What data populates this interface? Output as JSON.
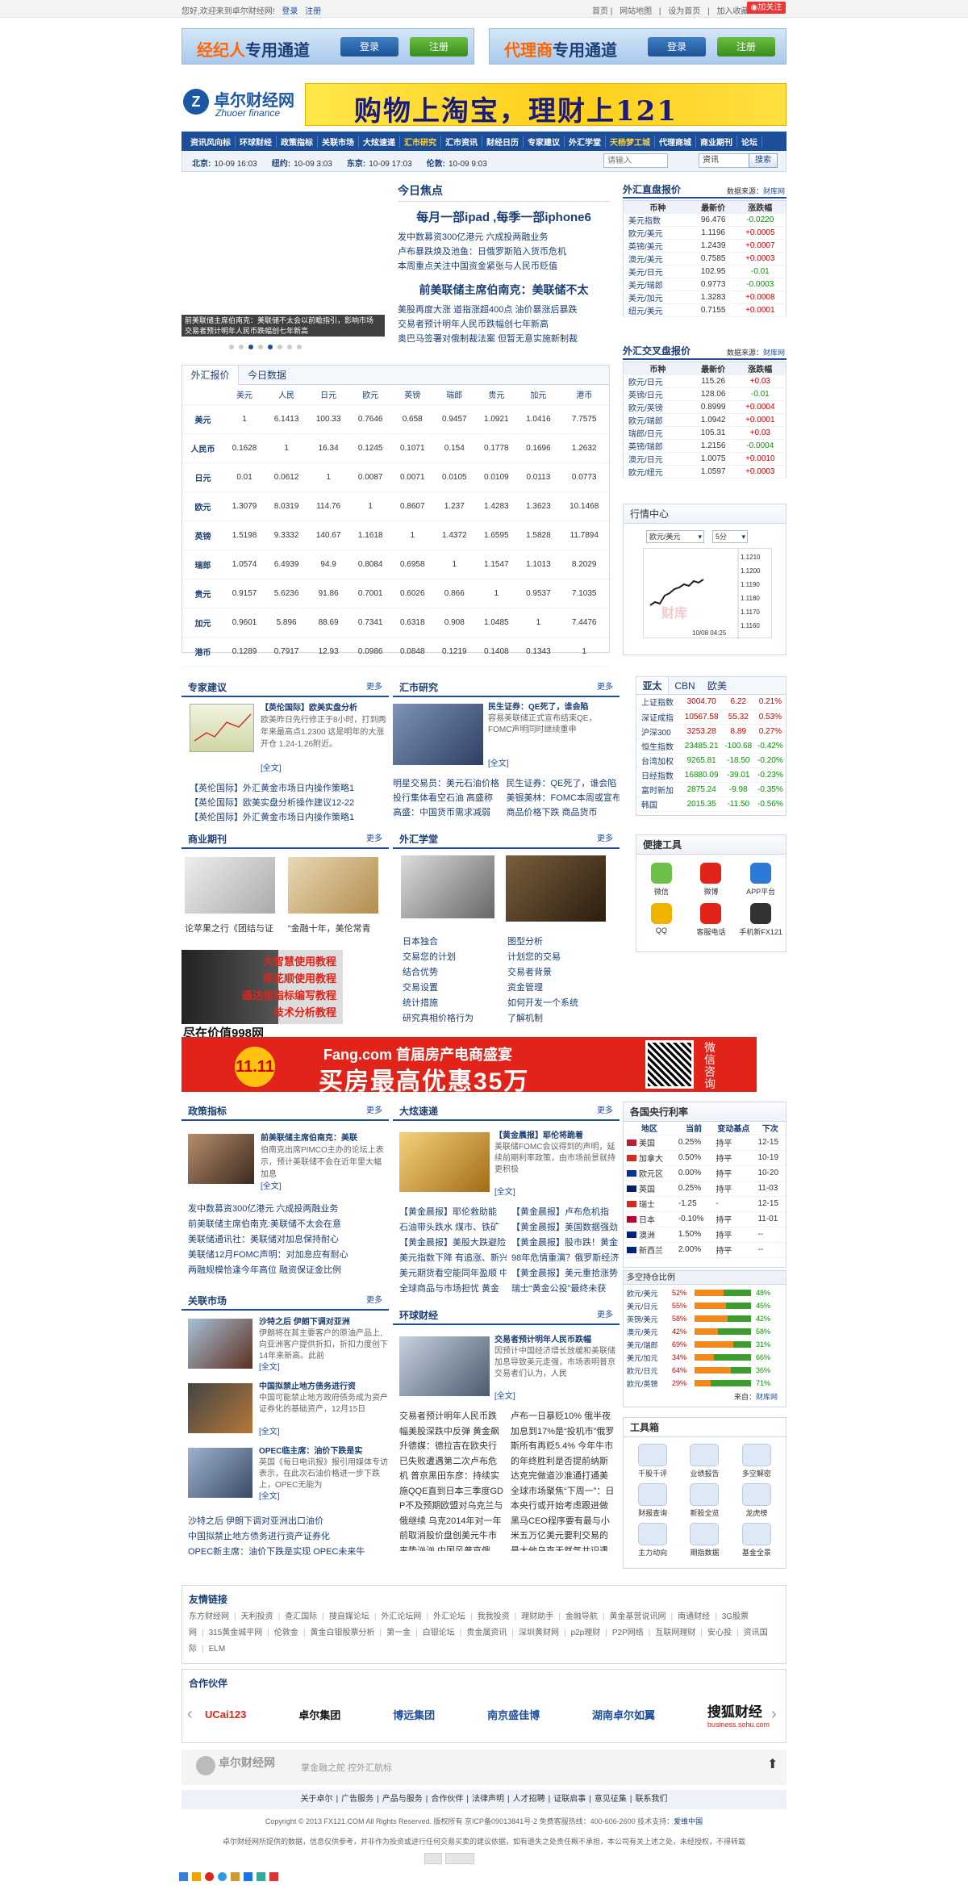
{
  "top": {
    "greet": "您好,欢迎来到卓尔财经网!",
    "login": "登录",
    "register": "注册",
    "home": "首页",
    "sitemap": "网站地图",
    "set_home": "设为首页",
    "bookmark": "加入收藏",
    "follow": "加关注"
  },
  "portal": {
    "broker": "经纪人",
    "broker_rest": "专用通道",
    "agent": "代理商",
    "agent_rest": "专用通道",
    "login": "登录",
    "register": "注册"
  },
  "brand": {
    "name": "卓尔财经网",
    "en": "Zhuoer finance",
    "ad": "购物上淘宝，理财上121"
  },
  "nav": {
    "row1": [
      "资讯风向标",
      "环球财经",
      "政策指标",
      "关联市场",
      "大炫速递",
      "汇市研究",
      "汇市资讯",
      "财经日历",
      "专家建议",
      "外汇学堂",
      "天杨梦工城",
      "代理商城",
      "商业期刊",
      "论坛"
    ]
  },
  "clock": {
    "items": [
      {
        "city": "北京:",
        "t": "10-09 16:03"
      },
      {
        "city": "纽约:",
        "t": "10-09 3:03"
      },
      {
        "city": "东京:",
        "t": "10-09 17:03"
      },
      {
        "city": "伦敦:",
        "t": "10-09 9:03"
      }
    ],
    "search_ph": "请输入",
    "select": "资讯",
    "search_btn": "搜索"
  },
  "hero": {
    "caption1": "前美联储主席伯南克：美联储不太会以前瞻指引，影响市场",
    "caption2": "交易者预计明年人民币跌幅创七年新高"
  },
  "focus": {
    "title": "今日焦点",
    "h1": "每月一部ipad ,每季一部iphone6",
    "list1": [
      "发中数募资300亿港元 六成投两融业务",
      "卢布暴跌焕及池鱼：日俄罗斯陷入货币危机",
      "本周重点关注中国资金紧张与人民币贬值"
    ],
    "h2": "前美联储主席伯南克：美联储不太",
    "list2": [
      "美股再度大涨 道指涨超400点 油价暴涨后暴跌",
      "交易者预计明年人民币跌幅创七年新高",
      "奥巴马签署对俄制裁法案 但暂无意实施新制裁"
    ]
  },
  "fxtab": {
    "tab1": "外汇报价",
    "tab2": "今日数据",
    "cols": [
      "",
      "美元",
      "人民",
      "日元",
      "欧元",
      "英镑",
      "瑞郎",
      "贵元",
      "加元",
      "港币"
    ],
    "rows": [
      [
        "美元",
        "1",
        "6.1413",
        "100.33",
        "0.7646",
        "0.658",
        "0.9457",
        "1.0921",
        "1.0416",
        "7.7575"
      ],
      [
        "人民币",
        "0.1628",
        "1",
        "16.34",
        "0.1245",
        "0.1071",
        "0.154",
        "0.1778",
        "0.1696",
        "1.2632"
      ],
      [
        "日元",
        "0.01",
        "0.0612",
        "1",
        "0.0087",
        "0.0071",
        "0.0105",
        "0.0109",
        "0.0113",
        "0.0773"
      ],
      [
        "欧元",
        "1.3079",
        "8.0319",
        "114.76",
        "1",
        "0.8607",
        "1.237",
        "1.4283",
        "1.3623",
        "10.1468"
      ],
      [
        "英镑",
        "1.5198",
        "9.3332",
        "140.67",
        "1.1618",
        "1",
        "1.4372",
        "1.6595",
        "1.5828",
        "11.7894"
      ],
      [
        "瑞郎",
        "1.0574",
        "6.4939",
        "94.9",
        "0.8084",
        "0.6958",
        "1",
        "1.1547",
        "1.1013",
        "8.2029"
      ],
      [
        "贵元",
        "0.9157",
        "5.6236",
        "91.86",
        "0.7001",
        "0.6026",
        "0.866",
        "1",
        "0.9537",
        "7.1035"
      ],
      [
        "加元",
        "0.9601",
        "5.896",
        "88.69",
        "0.7341",
        "0.6318",
        "0.908",
        "1.0485",
        "1",
        "7.4476"
      ],
      [
        "港币",
        "0.1289",
        "0.7917",
        "12.93",
        "0.0986",
        "0.0848",
        "0.1219",
        "0.1408",
        "0.1343",
        "1"
      ]
    ]
  },
  "direct": {
    "title": "外汇直盘报价",
    "source_l": "数据来源：",
    "source": "财库网",
    "cols": [
      "币种",
      "最新价",
      "涨跌幅"
    ],
    "rows": [
      [
        "美元指数",
        "96.476",
        "-0.0220"
      ],
      [
        "欧元/美元",
        "1.1196",
        "+0.0005"
      ],
      [
        "英镑/美元",
        "1.2439",
        "+0.0007"
      ],
      [
        "澳元/美元",
        "0.7585",
        "+0.0003"
      ],
      [
        "美元/日元",
        "102.95",
        "-0.01"
      ],
      [
        "美元/瑞郎",
        "0.9773",
        "-0.0003"
      ],
      [
        "美元/加元",
        "1.3283",
        "+0.0008"
      ],
      [
        "纽元/美元",
        "0.7155",
        "+0.0001"
      ]
    ]
  },
  "cross": {
    "title": "外汇交叉盘报价",
    "source_l": "数据来源：",
    "source": "财库网",
    "cols": [
      "币种",
      "最新价",
      "涨跌幅"
    ],
    "rows": [
      [
        "欧元/日元",
        "115.26",
        "+0.03"
      ],
      [
        "英镑/日元",
        "128.06",
        "-0.01"
      ],
      [
        "欧元/英镑",
        "0.8999",
        "+0.0004"
      ],
      [
        "欧元/瑞郎",
        "1.0942",
        "+0.0001"
      ],
      [
        "瑞郎/日元",
        "105.31",
        "+0.03"
      ],
      [
        "英镑/瑞郎",
        "1.2156",
        "-0.0004"
      ],
      [
        "澳元/日元",
        "1.0075",
        "+0.0010"
      ],
      [
        "欧元/纽元",
        "1.0597",
        "+0.0003"
      ]
    ]
  },
  "market": {
    "title": "行情中心",
    "pair": "欧元/美元",
    "period": "5分",
    "prices": [
      "1.1210",
      "1.1200",
      "1.1190",
      "1.1180",
      "1.1170",
      "1.1160"
    ],
    "watermark": "财库",
    "time": "10/08 04:25"
  },
  "expert": {
    "title": "专家建议",
    "more": "更多",
    "headline": "【英伦国际】欧美实盘分析",
    "desc": "欧美昨日先行修正于8小时，打到两年来最高点1.2300 这是明年的大涨开仓 1.24-1.26附近。",
    "full": "[全文]",
    "list": [
      "【英伦国际】外汇黄金市场日内操作策略1",
      "【英伦国际】欧美实盘分析操作建议12-22",
      "【英伦国际】外汇黄金市场日内操作策略1"
    ]
  },
  "research": {
    "title": "汇市研究",
    "more": "更多",
    "headline": "民生证券：QE死了，谁会陷",
    "desc": "容易美联储正式宣布结束QE，FOMC声明同时继续重申",
    "full": "[全文]",
    "list": [
      "明星交易员：美元石油价格",
      "民生证券：QE死了，谁会陷",
      "投行集体看空石油 高盛称",
      "美银美林：FOMC本周或宣布",
      "高盛：中国货币需求减弱",
      "商品价格下跌 商品货币"
    ]
  },
  "asia": {
    "tabs": [
      "亚太",
      "CBN",
      "欧美"
    ],
    "rows": [
      [
        "上证指数",
        "3004.70",
        "6.22",
        "0.21%"
      ],
      [
        "深证成指",
        "10567.58",
        "55.32",
        "0.53%"
      ],
      [
        "沪深300",
        "3253.28",
        "8.89",
        "0.27%"
      ],
      [
        "恒生指数",
        "23485.21",
        "-100.68",
        "-0.42%"
      ],
      [
        "台湾加权",
        "9265.81",
        "-18.50",
        "-0.20%"
      ],
      [
        "日经指数",
        "16880.09",
        "-39.01",
        "-0.23%"
      ],
      [
        "富时新加",
        "2875.24",
        "-9.98",
        "-0.35%"
      ],
      [
        "韩国",
        "2015.35",
        "-11.50",
        "-0.56%"
      ]
    ]
  },
  "journal": {
    "title": "商业期刊",
    "more": "更多",
    "items": [
      "论苹果之行《团结与证",
      "“金融十年，美伦常青"
    ]
  },
  "school": {
    "title": "外汇学堂",
    "more": "更多",
    "col1": [
      "日本独合",
      "交易您的计划",
      "结合优势",
      "交易设置",
      "统计措施",
      "研究真相价格行为"
    ],
    "col2": [
      "图型分析",
      "计划您的交易",
      "交易者背景",
      "资金管理",
      "如何开发一个系统",
      "了解机制"
    ]
  },
  "tools": {
    "title": "便捷工具",
    "items": [
      "微信",
      "微博",
      "APP平台",
      "QQ",
      "客服电话",
      "手机新FX121"
    ]
  },
  "tutorial": {
    "lines": [
      "大智慧使用教程",
      "同花顺使用教程",
      "通达信指标编写教程",
      "技术分析教程"
    ],
    "price": "尽在价值998网"
  },
  "banner": {
    "brand": "Fang.com",
    "t1": "首届房产电商盛宴",
    "t2": "买房最高优惠35万",
    "d": "11.11",
    "qr": "微信咨询"
  },
  "policy": {
    "title": "政策指标",
    "more": "更多",
    "headline": "前美联储主席伯南克：美联",
    "desc": "伯南克出席PIMCO主办的论坛上表示，预计美联储不会在近年里大幅加息",
    "full": "[全文]",
    "list": [
      "发中数募资300亿港元 六成投两融业务",
      "前美联储主席伯南克:美联储不太会在意",
      "美联储通讯社：美联储对加息保持耐心",
      "美联储12月FOMC声明：对加息应有耐心",
      "两融规模恰逢今年高位 融资保证金比例"
    ]
  },
  "express": {
    "title": "大炫速递",
    "more": "更多",
    "headline": "【黄金晨报】耶伦将跪着",
    "desc": "美联储FOMC会议得到的声明，延续前期利率政策，由市场前景就持更积极",
    "full": "[全文]",
    "list": [
      "【黄金晨报】耶伦救助能",
      "【黄金晨报】卢布危机指",
      "石油带头跌水 煤市、铁矿",
      "【黄金晨报】美国数据强劲",
      "【黄金晨报】美股大跌避险",
      "【黄金晨报】股市跌！黄金",
      "美元指数下降 有追涨、新兴",
      "98年危情重演？俄罗斯经济",
      "美元期货看空能同年盈顺 中",
      "【黄金晨报】美元重拾涨势",
      "全球商品与市场担忧 黄金",
      "瑞士“黄金公投”最终未获"
    ]
  },
  "rates": {
    "title": "各国央行利率",
    "cols": [
      "地区",
      "当前",
      "变动基点",
      "下次"
    ],
    "rows": [
      [
        "美国",
        "0.25%",
        "持平",
        "12-15"
      ],
      [
        "加拿大",
        "0.50%",
        "持平",
        "10-19"
      ],
      [
        "欧元区",
        "0.00%",
        "持平",
        "10-20"
      ],
      [
        "英国",
        "0.25%",
        "持平",
        "11-03"
      ],
      [
        "瑞士",
        "-1.25",
        "-",
        "12-15"
      ],
      [
        "日本",
        "-0.10%",
        "持平",
        "11-01"
      ],
      [
        "澳洲",
        "1.50%",
        "持平",
        "--"
      ],
      [
        "新西兰",
        "2.00%",
        "持平",
        "--"
      ]
    ]
  },
  "ls": {
    "title": "多空持仓比例",
    "rows": [
      [
        "欧元/美元",
        "52%",
        "48%"
      ],
      [
        "美元/日元",
        "55%",
        "45%"
      ],
      [
        "英镑/美元",
        "58%",
        "42%"
      ],
      [
        "澳元/美元",
        "42%",
        "58%"
      ],
      [
        "美元/瑞郎",
        "69%",
        "31%"
      ],
      [
        "美元/加元",
        "34%",
        "66%"
      ],
      [
        "欧元/日元",
        "64%",
        "36%"
      ],
      [
        "欧元/英镑",
        "29%",
        "71%"
      ]
    ],
    "src_l": "来自：",
    "src": "财库网"
  },
  "related": {
    "title": "关联市场",
    "more": "更多",
    "items": [
      {
        "h": "沙特之后 伊朗下调对亚洲",
        "d": "伊朗将在其主要客户的原油产品上,向亚洲客户提供折扣，折扣力度创下14年来新高。此前",
        "f": "[全文]"
      },
      {
        "h": "中国拟禁止地方债务进行资",
        "d": "中国可能禁止地方政府债务成为资产证券化的基础资产，12月15日",
        "f": "[全文]"
      },
      {
        "h": "OPEC临主席：油价下跌是实",
        "d": "英国《每日电讯报》报引用媒体专访表示，在此次石油价格进一步下跌上，OPEC无能为",
        "f": "[全文]"
      }
    ],
    "list": [
      "沙特之后 伊朗下调对亚洲出口油价",
      "中国拟禁止地方债务进行资产证券化",
      "OPEC新主席：油价下跌是实现 OPEC未来牛"
    ]
  },
  "global": {
    "title": "环球财经",
    "more": "更多",
    "headline": "交易者预计明年人民币跌幅",
    "desc": "因预计中国经济增长放缓和美联储加息导致美元走强，市场表明普京交易者们认为，人民",
    "full": "[全文]",
    "col1": "交易者预计明年人民币跌幅美股深跌中反弹 黄金飙升德媒：德拉吉在欧央行已失败遭遇第二次卢布危机 普京黑田东彦：持续实施QQE直到日本三季度GDP不及预期欧盟对乌克兰与俄继续 乌克2014年对一年前取消股价盘创美元牛市来势汹汹 中国风普京俄版“钱骡满池”挑",
    "col2": "卢布一日暴贬10% 俄半夜加息到17%是“投机市”俄罗斯所有再贬5.4% 今年牛市的年终胜利是否提前纳斯达克完做道沙准通打通美全球市场聚焦“下周一”：日本央行或开始考虑跟进做黑马CEO程序要有最与小米五万亿美元要利交易的最大他乌克天然气共识遇到暗中"
  },
  "toolbox": {
    "title": "工具箱",
    "items": [
      "千股千评",
      "业绩报告",
      "多空解密",
      "财报查询",
      "新股全览",
      "龙虎榜",
      "主力动向",
      "期指数据",
      "基金全景"
    ]
  },
  "friends": {
    "title": "友情链接",
    "links": [
      "东方财经网",
      "天利投资",
      "查汇国际",
      "搜自媒论坛",
      "外汇论坛网",
      "外汇论坛",
      "我我投资",
      "理财助手",
      "金融导航",
      "黄金基营说讯网",
      "南通财经",
      "3G股票网",
      "315黄金城平网",
      "伦敦金",
      "黄金白银股票分析",
      "第一金",
      "白银论坛",
      "贵金属资讯",
      "深圳黄财网",
      "p2p理财",
      "P2P网络",
      "互联网理财",
      "安心投",
      "资讯国际",
      "ELM"
    ]
  },
  "partners": {
    "title": "合作伙伴",
    "items": [
      "UCai123",
      "卓尔集团",
      "博远集团",
      "南京盛佳博",
      "湖南卓尔如翼",
      "搜狐财经"
    ],
    "sohu": "business.sohu.com"
  },
  "footer": {
    "brand": "卓尔财经网",
    "slogan": "掌金融之舵 控外汇航标",
    "links": [
      "关于卓尔",
      "广告服务",
      "产品与服务",
      "合作伙伴",
      "法律声明",
      "人才招聘",
      "证联启事",
      "意见征集",
      "联系我们"
    ],
    "copy": "Copyright © 2013 FX121.COM All Rights Reserved. 版权所有 京ICP备09013841号-2 免费客服热线：400-606-2600 技术支持：",
    "tech": "爱维中国",
    "note": "卓尔财经网所提供的数据，信息仅供参考，并非作为投资或进行任何交易买卖的建议依据，如有遗失之处责任概不承担，本公司有关上述之处，未经授权，不得转载"
  }
}
